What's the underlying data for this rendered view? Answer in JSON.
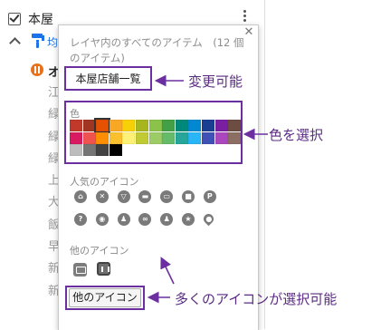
{
  "layer": {
    "title": "本屋",
    "first_item": "オ",
    "items": [
      "江",
      "緑",
      "緑",
      "緑",
      "上",
      "大",
      "飯",
      "早",
      "新",
      "新"
    ],
    "partial_label": "均"
  },
  "popup": {
    "heading": "レイヤ内のすべてのアイテム　(12 個のアイテム)",
    "name_value": "本屋店舗一覧",
    "color_label": "色",
    "popular_icons_label": "人気のアイコン",
    "other_icons_label": "他のアイコン",
    "more_icons_button": "他のアイコン",
    "close_icon": "close-icon",
    "colors": [
      [
        "#c0392b",
        "#a03522",
        "#e65100",
        "#f9a825",
        "#f7d008",
        "#a7b61f",
        "#8bc34a",
        "#43a047",
        "#00897b",
        "#0288d1",
        "#1a3e91",
        "#7b1fa2",
        "#6d4c41"
      ],
      [
        "#d81b60",
        "#ef5350",
        "#ff8f00",
        "#fbc02d",
        "#fff176",
        "#c0ca33",
        "#9ccc65",
        "#66bb6a",
        "#26a69a",
        "#29b6f6",
        "#3f51b5",
        "#ab47bc",
        "#8d6e63"
      ],
      [
        "#bdbdbd",
        "#757575",
        "#424242",
        "#000000"
      ]
    ],
    "selected_color": "#e65100",
    "popular_icons": [
      {
        "name": "home-icon",
        "glyph": "⌂"
      },
      {
        "name": "restaurant-icon",
        "glyph": "✕"
      },
      {
        "name": "bar-icon",
        "glyph": "▽"
      },
      {
        "name": "shopping-icon",
        "glyph": "▬"
      },
      {
        "name": "hotel-icon",
        "glyph": "▭"
      },
      {
        "name": "shopping-bag-icon",
        "glyph": "■"
      },
      {
        "name": "parking-icon",
        "glyph": "P"
      },
      {
        "name": "help-icon",
        "glyph": "?"
      },
      {
        "name": "camera-icon",
        "glyph": "◉"
      },
      {
        "name": "walking-icon",
        "glyph": "♟"
      },
      {
        "name": "bicycle-icon",
        "glyph": "∞"
      },
      {
        "name": "running-icon",
        "glyph": "♟"
      },
      {
        "name": "star-icon",
        "glyph": "★"
      },
      {
        "name": "pin-icon",
        "glyph": "●"
      }
    ]
  },
  "annotations": {
    "changeable": "変更可能",
    "color_select": "色を選択",
    "many_icons": "多くのアイコンが選択可能"
  },
  "colors": {
    "annotation_purple": "#6b2fa0"
  }
}
